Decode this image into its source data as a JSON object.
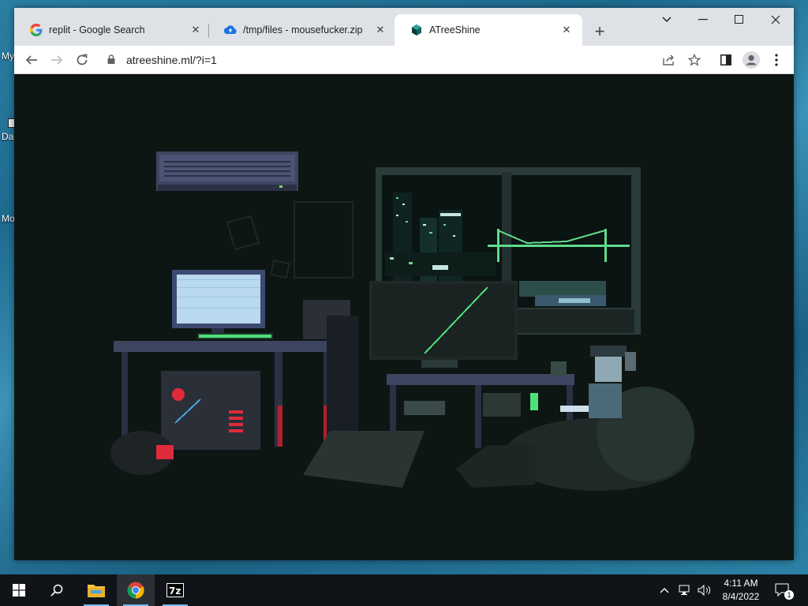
{
  "desktop": {
    "icons": [
      {
        "label": "My"
      },
      {
        "label": "Da"
      },
      {
        "label": "Mo"
      }
    ]
  },
  "browser": {
    "tabs": [
      {
        "title": "replit - Google Search",
        "favicon": "google-g-icon"
      },
      {
        "title": "/tmp/files - mousefucker.zip",
        "favicon": "cloud-upload-icon"
      },
      {
        "title": "ATreeShine",
        "favicon": "hexagon-icon",
        "active": true
      }
    ],
    "url": "atreeshine.ml/?i=1"
  },
  "scene": {
    "description_colors": {
      "background": "#0e1614",
      "monitor_glow": "#b9d9ef",
      "accent_green": "#4fe07a",
      "accent_red": "#e02b3a",
      "bridge_green": "#5fdc8a",
      "bluegray": "#3d4560"
    }
  },
  "taskbar": {
    "time": "4:11 AM",
    "date": "8/4/2022",
    "notification_count": "1"
  }
}
